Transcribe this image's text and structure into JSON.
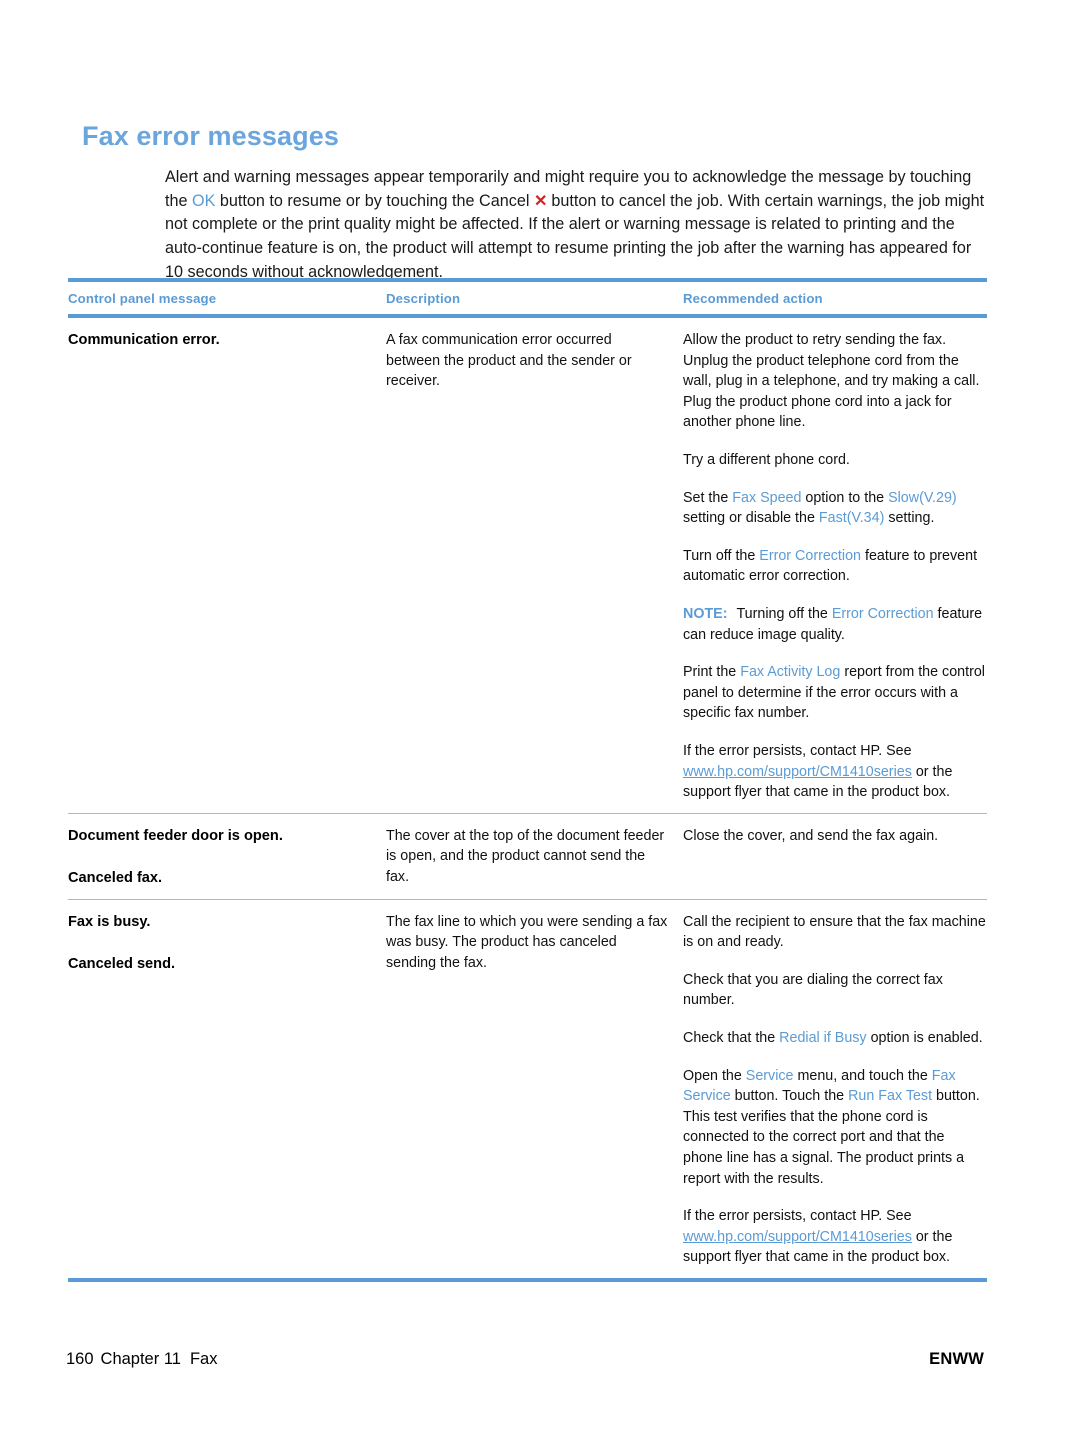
{
  "page": {
    "heading": "Fax error messages",
    "intro": {
      "part1": "Alert and warning messages appear temporarily and might require you to acknowledge the message by touching the ",
      "ok_label": "OK",
      "part2": " button to resume or by touching the Cancel ",
      "cancel_icon": "✕",
      "part3": " button to cancel the job. With certain warnings, the job might not complete or the print quality might be affected. If the alert or warning message is related to printing and the auto-continue feature is on, the product will attempt to resume printing the job after the warning has appeared for 10 seconds without acknowledgement."
    }
  },
  "table": {
    "headers": {
      "col1": "Control panel message",
      "col2": "Description",
      "col3": "Recommended action"
    },
    "rows": [
      {
        "messages": [
          "Communication error."
        ],
        "description": "A fax communication error occurred between the product and the sender or receiver.",
        "actions": {
          "p1": "Allow the product to retry sending the fax. Unplug the product telephone cord from the wall, plug in a telephone, and try making a call. Plug the product phone cord into a jack for another phone line.",
          "p2": "Try a different phone cord.",
          "p3_a": "Set the ",
          "p3_ui1": "Fax Speed",
          "p3_b": " option to the ",
          "p3_ui2": "Slow(V.29)",
          "p3_c": " setting or disable the ",
          "p3_ui3": "Fast(V.34)",
          "p3_d": " setting.",
          "p4_a": "Turn off the ",
          "p4_ui1": "Error Correction",
          "p4_b": " feature to prevent automatic error correction.",
          "p5_note": "NOTE:",
          "p5_a": "Turning off the ",
          "p5_ui1": "Error Correction",
          "p5_b": " feature can reduce image quality.",
          "p6_a": "Print the ",
          "p6_ui1": "Fax Activity Log",
          "p6_b": " report from the control panel to determine if the error occurs with a specific fax number.",
          "p7_a": "If the error persists, contact HP. See ",
          "p7_url": "www.hp.com/support/CM1410series",
          "p7_b": " or the support flyer that came in the product box."
        }
      },
      {
        "messages": [
          "Document feeder door is open.",
          "Canceled fax."
        ],
        "description": "The cover at the top of the document feeder is open, and the product cannot send the fax.",
        "actions": {
          "p1": "Close the cover, and send the fax again."
        }
      },
      {
        "messages": [
          "Fax is busy.",
          "Canceled send."
        ],
        "description": "The fax line to which you were sending a fax was busy. The product has canceled sending the fax.",
        "actions": {
          "p1": "Call the recipient to ensure that the fax machine is on and ready.",
          "p2": "Check that you are dialing the correct fax number.",
          "p3_a": "Check that the ",
          "p3_ui1": "Redial if Busy",
          "p3_b": " option is enabled.",
          "p4_a": "Open the ",
          "p4_ui1": "Service",
          "p4_b": " menu, and touch the ",
          "p4_ui2": "Fax Service",
          "p4_c": " button. Touch the ",
          "p4_ui3": "Run Fax Test",
          "p4_d": " button. This test verifies that the phone cord is connected to the correct port and that the phone line has a signal. The product prints a report with the results.",
          "p5_a": "If the error persists, contact HP. See ",
          "p5_url": "www.hp.com/support/CM1410series",
          "p5_b": " or the support flyer that came in the product box."
        }
      }
    ]
  },
  "footer": {
    "page_number": "160",
    "chapter": "Chapter 11",
    "section": "Fax",
    "right": "ENWW"
  },
  "colors": {
    "accent_blue": "#5b9bd5",
    "heading_blue": "#6aa6dd",
    "cancel_red": "#d42020"
  }
}
